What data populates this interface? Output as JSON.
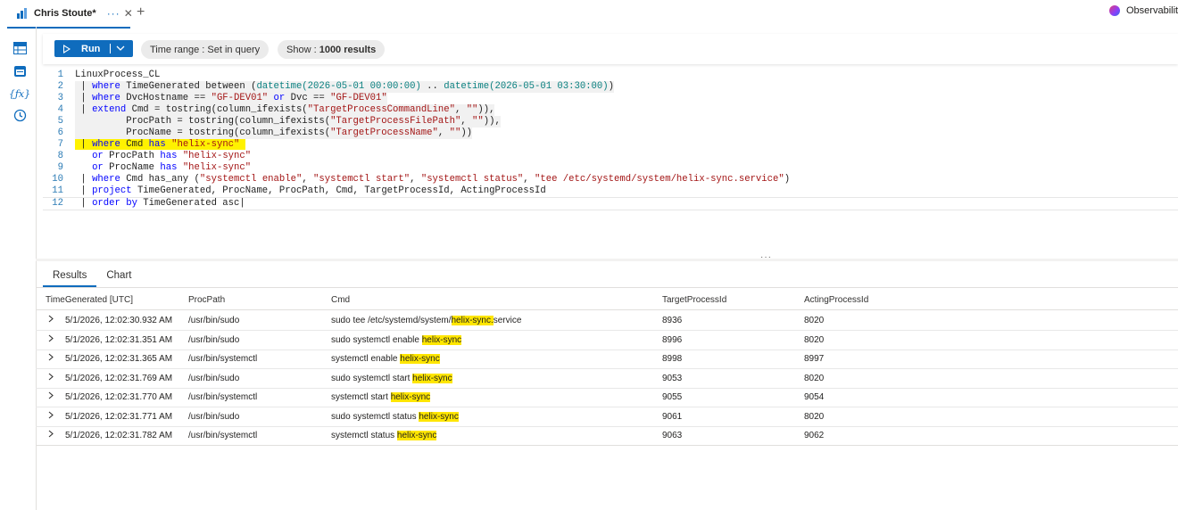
{
  "tab": {
    "title": "Chris Stoute*",
    "more": "···",
    "close": "✕"
  },
  "new_tab": "+",
  "brand": {
    "label": "Observability"
  },
  "toolbar": {
    "run_label": "Run",
    "time_range_label": "Time range : ",
    "time_range_value": "Set in query",
    "show_label": "Show : ",
    "show_value": "1000 results"
  },
  "editor": {
    "lines": [
      "1",
      "2",
      "3",
      "4",
      "5",
      "6",
      "7",
      "8",
      "9",
      "10",
      "11",
      "12"
    ]
  },
  "results": {
    "tabs": [
      "Results",
      "Chart"
    ],
    "columns": [
      "TimeGenerated [UTC]",
      "ProcPath",
      "Cmd",
      "TargetProcessId",
      "ActingProcessId"
    ],
    "rows": [
      {
        "time": "5/1/2026, 12:02:30.932 AM",
        "path": "/usr/bin/sudo",
        "cmd_pre": "sudo tee /etc/systemd/system/",
        "cmd_mark": "helix-sync.",
        "cmd_post": "service",
        "target": "8936",
        "acting": "8020"
      },
      {
        "time": "5/1/2026, 12:02:31.351 AM",
        "path": "/usr/bin/sudo",
        "cmd_pre": "sudo systemctl enable ",
        "cmd_mark": "helix-sync",
        "cmd_post": "",
        "target": "8996",
        "acting": "8020"
      },
      {
        "time": "5/1/2026, 12:02:31.365 AM",
        "path": "/usr/bin/systemctl",
        "cmd_pre": "systemctl enable ",
        "cmd_mark": "helix-sync",
        "cmd_post": "",
        "target": "8998",
        "acting": "8997"
      },
      {
        "time": "5/1/2026, 12:02:31.769 AM",
        "path": "/usr/bin/sudo",
        "cmd_pre": "sudo systemctl start ",
        "cmd_mark": "helix-sync",
        "cmd_post": "",
        "target": "9053",
        "acting": "8020"
      },
      {
        "time": "5/1/2026, 12:02:31.770 AM",
        "path": "/usr/bin/systemctl",
        "cmd_pre": "systemctl start ",
        "cmd_mark": "helix-sync",
        "cmd_post": "",
        "target": "9055",
        "acting": "9054"
      },
      {
        "time": "5/1/2026, 12:02:31.771 AM",
        "path": "/usr/bin/sudo",
        "cmd_pre": "sudo systemctl status ",
        "cmd_mark": "helix-sync ",
        "cmd_post": "",
        "target": "9061",
        "acting": "8020"
      },
      {
        "time": "5/1/2026, 12:02:31.782 AM",
        "path": "/usr/bin/systemctl",
        "cmd_pre": "systemctl status ",
        "cmd_mark": "helix-sync ",
        "cmd_post": "",
        "target": "9063",
        "acting": "9062"
      }
    ]
  },
  "colors": {
    "accent": "#0f6cbd",
    "highlight": "#fff200"
  },
  "icons": [
    "tables-icon",
    "queries-icon",
    "functions-icon",
    "history-icon"
  ]
}
